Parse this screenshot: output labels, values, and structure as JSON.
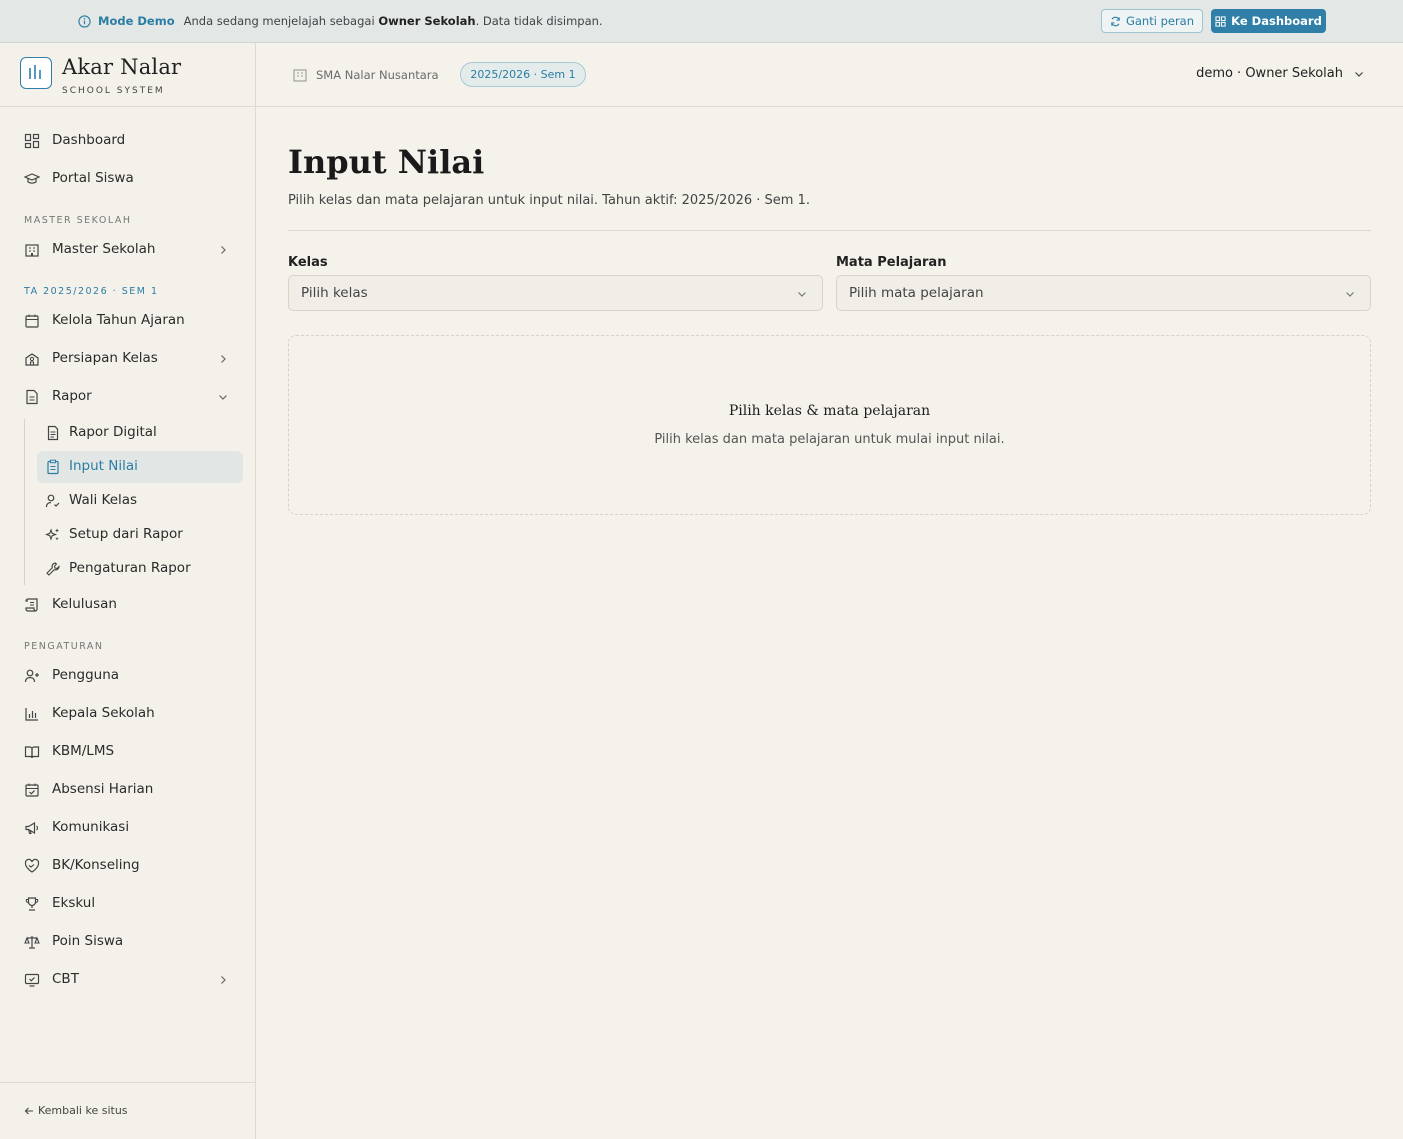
{
  "banner": {
    "mode_label": "Mode Demo",
    "text_before": "Anda sedang menjelajah sebagai",
    "role": "Owner Sekolah",
    "text_after": ". Data tidak disimpan.",
    "switch_role_label": "Ganti peran",
    "dashboard_label": "Ke Dashboard"
  },
  "brand": {
    "name": "Akar Nalar",
    "subtitle": "SCHOOL SYSTEM"
  },
  "sidebar": {
    "items": {
      "dashboard": "Dashboard",
      "portal_siswa": "Portal Siswa",
      "master_sekolah": "Master Sekolah",
      "kelola_tahun_ajaran": "Kelola Tahun Ajaran",
      "persiapan_kelas": "Persiapan Kelas",
      "rapor": "Rapor",
      "rapor_digital": "Rapor Digital",
      "input_nilai": "Input Nilai",
      "wali_kelas": "Wali Kelas",
      "setup_dari_rapor": "Setup dari Rapor",
      "pengaturan_rapor": "Pengaturan Rapor",
      "kelulusan": "Kelulusan",
      "pengguna": "Pengguna",
      "kepala_sekolah": "Kepala Sekolah",
      "kbm_lms": "KBM/LMS",
      "absensi_harian": "Absensi Harian",
      "komunikasi": "Komunikasi",
      "bk_konseling": "BK/Konseling",
      "ekskul": "Ekskul",
      "poin_siswa": "Poin Siswa",
      "cbt": "CBT"
    },
    "sections": {
      "master": "MASTER SEKOLAH",
      "ta": "TA 2025/2026 · SEM 1",
      "pengaturan": "PENGATURAN"
    },
    "back_label": "Kembali ke situs"
  },
  "topbar": {
    "school_name": "SMA Nalar Nusantara",
    "year_badge": "2025/2026 · Sem 1",
    "user_label": "demo · Owner Sekolah"
  },
  "main": {
    "title": "Input Nilai",
    "subtitle": "Pilih kelas dan mata pelajaran untuk input nilai. Tahun aktif: 2025/2026 · Sem 1.",
    "kelas_label": "Kelas",
    "kelas_placeholder": "Pilih kelas",
    "mapel_label": "Mata Pelajaran",
    "mapel_placeholder": "Pilih mata pelajaran",
    "empty_title": "Pilih kelas & mata pelajaran",
    "empty_text": "Pilih kelas dan mata pelajaran untuk mulai input nilai."
  },
  "colors": {
    "accent": "#2f7fa8",
    "background": "#f5f2ec",
    "active_item_bg": "#e2e6e5"
  }
}
